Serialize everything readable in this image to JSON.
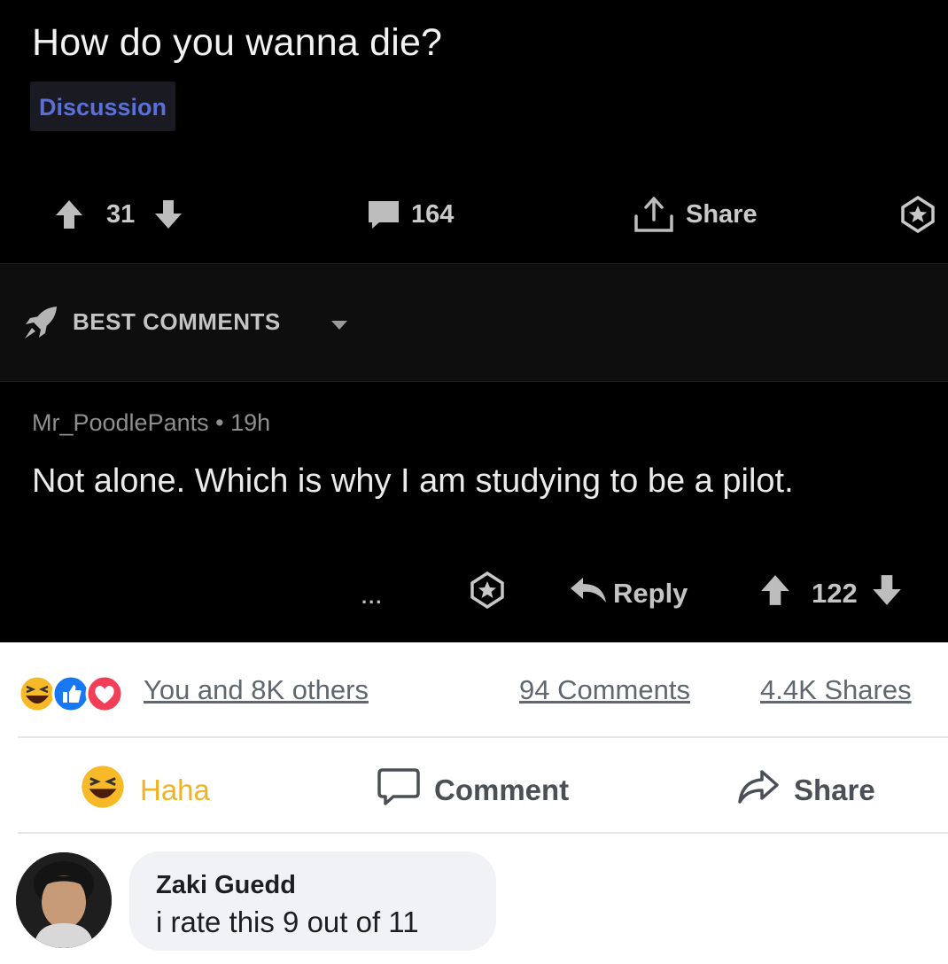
{
  "post": {
    "title": "How do you wanna die?",
    "flair": "Discussion",
    "score": "31",
    "comments_count": "164",
    "share_label": "Share"
  },
  "sort": {
    "label": "BEST COMMENTS"
  },
  "comment": {
    "username": "Mr_PoodlePants",
    "separator": "•",
    "time": "19h",
    "body": "Not alone.  Which is why I am studying to be a pilot.",
    "more_label": "...",
    "reply_label": "Reply",
    "score": "122"
  },
  "facebook": {
    "reactions_text": "You and 8K others",
    "comments_text": "94 Comments",
    "shares_text": "4.4K Shares",
    "reaction_label": "Haha",
    "comment_label": "Comment",
    "share_label": "Share",
    "reply": {
      "name": "Zaki Guedd",
      "text": "i rate this 9 out of 11"
    },
    "colors": {
      "haha": "#f7b928",
      "like": "#1877f2",
      "love": "#f33e58"
    }
  },
  "icons": [
    "upvote-icon",
    "downvote-icon",
    "comment-icon",
    "share-icon",
    "award-icon",
    "rocket-icon",
    "caret-down-icon",
    "reply-arrow-icon",
    "haha-reaction-icon",
    "like-reaction-icon",
    "love-reaction-icon",
    "speech-bubble-icon",
    "share-arrow-icon"
  ]
}
